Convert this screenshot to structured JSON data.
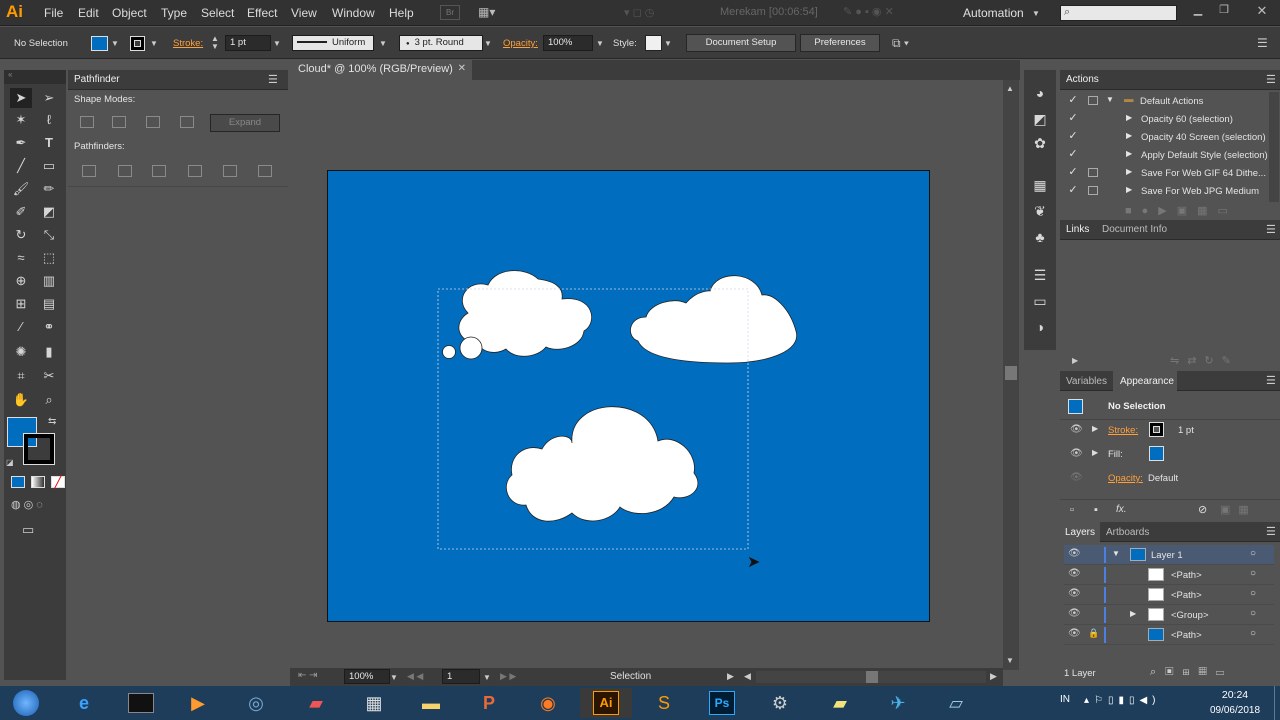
{
  "app": {
    "logo": "Ai",
    "menus": [
      "File",
      "Edit",
      "Object",
      "Type",
      "Select",
      "Effect",
      "View",
      "Window",
      "Help"
    ],
    "recording": "Merekam [00:06:54]",
    "workspace": "Automation"
  },
  "control_bar": {
    "selection": "No Selection",
    "stroke_label": "Stroke:",
    "stroke_weight": "1 pt",
    "profile": "Uniform",
    "brush": "3 pt. Round",
    "opacity_label": "Opacity:",
    "opacity_value": "100%",
    "style_label": "Style:",
    "document_setup": "Document Setup",
    "preferences": "Preferences"
  },
  "pathfinder": {
    "title": "Pathfinder",
    "shape_modes": "Shape Modes:",
    "expand": "Expand",
    "pathfinders": "Pathfinders:"
  },
  "document": {
    "tab_title": "Cloud* @ 100% (RGB/Preview)",
    "artboard_color": "#016dbf",
    "zoom": "100%",
    "page": "1",
    "status": "Selection"
  },
  "actions": {
    "tab": "Actions",
    "items": [
      {
        "label": "Default Actions"
      },
      {
        "label": "Opacity 60 (selection)"
      },
      {
        "label": "Opacity 40 Screen (selection)"
      },
      {
        "label": "Apply Default Style (selection)"
      },
      {
        "label": "Save For Web GIF 64 Dithe..."
      },
      {
        "label": "Save For Web JPG Medium"
      }
    ]
  },
  "links_panel": {
    "tabs": [
      "Links",
      "Document Info"
    ]
  },
  "appearance": {
    "tabs": [
      "Variables",
      "Appearance"
    ],
    "title": "No Selection",
    "stroke_label": "Stroke:",
    "stroke_value": "1 pt",
    "fill_label": "Fill:",
    "opacity_label": "Opacity:",
    "opacity_value": "Default",
    "fx": "fx."
  },
  "layers": {
    "tabs": [
      "Layers",
      "Artboards"
    ],
    "items": [
      {
        "label": "Layer 1"
      },
      {
        "label": "<Path>"
      },
      {
        "label": "<Path>"
      },
      {
        "label": "<Group>"
      },
      {
        "label": "<Path>"
      }
    ],
    "count": "1 Layer"
  },
  "taskbar": {
    "lang": "IN",
    "time": "20:24",
    "date": "09/06/2018"
  }
}
